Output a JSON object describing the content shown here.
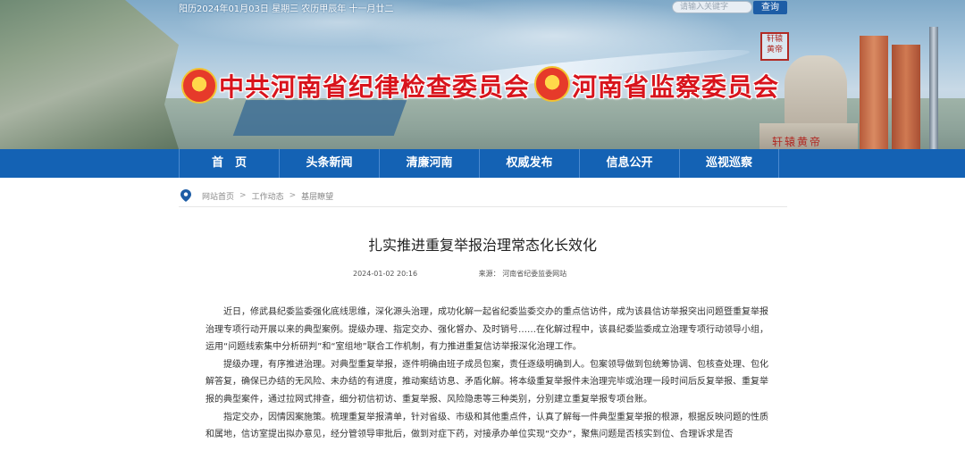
{
  "topbar": {
    "date_text": "阳历2024年01月03日 星期三 农历甲辰年 十一月廿二",
    "search_placeholder": "请输入关键字",
    "search_button": "查询"
  },
  "header": {
    "org_left": "中共河南省纪律检查委员会",
    "org_right": "河南省监察委员会",
    "brush_text": "轩辕黄帝",
    "seal_text": "轩辕黄帝"
  },
  "nav": {
    "items": [
      {
        "label": "首　页"
      },
      {
        "label": "头条新闻"
      },
      {
        "label": "清廉河南"
      },
      {
        "label": "权威发布"
      },
      {
        "label": "信息公开"
      },
      {
        "label": "巡视巡察"
      }
    ]
  },
  "breadcrumb": [
    "网站首页",
    "工作动态",
    "基层瞭望"
  ],
  "article": {
    "title": "扎实推进重复举报治理常态化长效化",
    "date": "2024-01-02 20:16",
    "source_label": "来源：",
    "source": "河南省纪委监委网站",
    "paragraphs": [
      "近日，修武县纪委监委强化底线思维，深化源头治理，成功化解一起省纪委监委交办的重点信访件，成为该县信访举报突出问题暨重复举报治理专项行动开展以来的典型案例。提级办理、指定交办、强化督办、及时销号……在化解过程中，该县纪委监委成立治理专项行动领导小组，运用“问题线索集中分析研判”和“室组地”联合工作机制，有力推进重复信访举报深化治理工作。",
      "提级办理，有序推进治理。对典型重复举报，逐件明确由班子成员包案，责任逐级明确到人。包案领导做到包统筹协调、包核查处理、包化解答复，确保已办结的无风险、未办结的有进度，推动案结访息、矛盾化解。将本级重复举报件未治理完毕或治理一段时间后反复举报、重复举报的典型案件，通过拉网式排查，细分初信初访、重复举报、风险隐患等三种类别，分别建立重复举报专项台账。",
      "指定交办，因情因案施策。梳理重复举报清单，针对省级、市级和其他重点件，认真了解每一件典型重复举报的根源，根据反映问题的性质和属地，信访室提出拟办意见，经分管领导审批后，做到对症下药，对接承办单位实现“交办”，聚焦问题是否核实到位、合理诉求是否"
    ]
  }
}
